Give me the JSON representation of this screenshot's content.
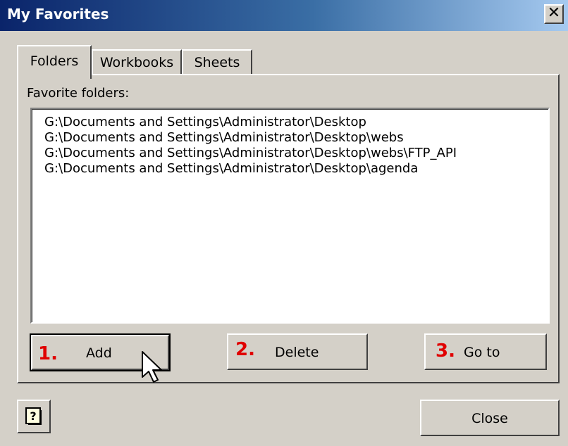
{
  "window": {
    "title": "My Favorites",
    "close_glyph": "✕"
  },
  "tabs": [
    {
      "label": "Folders",
      "active": true
    },
    {
      "label": "Workbooks",
      "active": false
    },
    {
      "label": "Sheets",
      "active": false
    }
  ],
  "folders": {
    "label": "Favorite folders:",
    "items": [
      "G:\\Documents and Settings\\Administrator\\Desktop",
      "G:\\Documents and Settings\\Administrator\\Desktop\\webs",
      "G:\\Documents and Settings\\Administrator\\Desktop\\webs\\FTP_API",
      "G:\\Documents and Settings\\Administrator\\Desktop\\agenda"
    ]
  },
  "buttons": {
    "add": {
      "number": "1.",
      "label": "Add"
    },
    "delete": {
      "number": "2.",
      "label": "Delete"
    },
    "goto": {
      "number": "3.",
      "label": "Go to"
    },
    "close": {
      "label": "Close"
    },
    "help_icon": "help-question-icon"
  },
  "colors": {
    "title_gradient_start": "#0a246a",
    "title_gradient_end": "#a6caf0",
    "step_number": "#e00000",
    "dialog_face": "#d4d0c8"
  }
}
